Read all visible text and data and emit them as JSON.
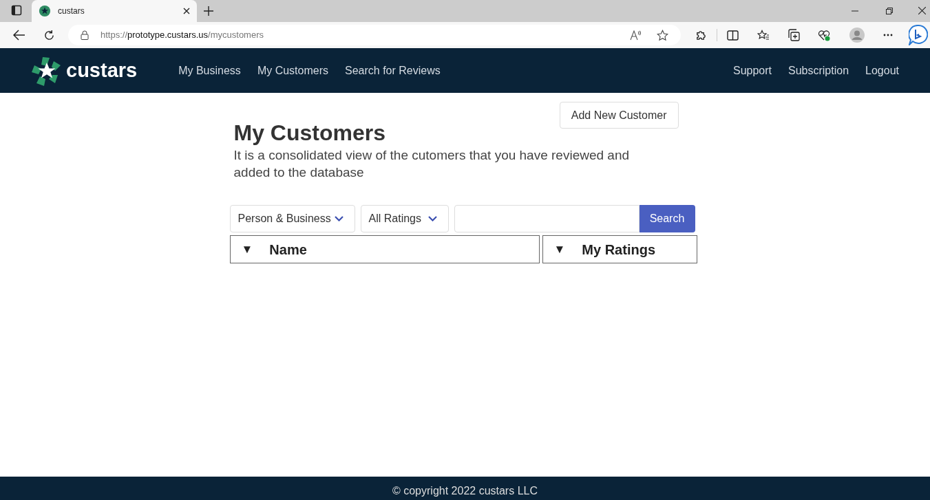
{
  "browser": {
    "tab": {
      "title": "custars",
      "selected": true
    },
    "url_parts": [
      {
        "text": "https://",
        "kind": "dim"
      },
      {
        "text": "prototype.custars.us",
        "kind": "main"
      },
      {
        "text": "/mycustomers",
        "kind": "dim"
      }
    ]
  },
  "nav": {
    "logo": "custars",
    "links": [
      "My Business",
      "My Customers",
      "Search for Reviews"
    ],
    "right_links": [
      "Support",
      "Subscription",
      "Logout"
    ]
  },
  "page": {
    "add_button": "Add New Customer",
    "title": "My Customers",
    "description": "It is a consolidated view of the cutomers that you have reviewed and added to the database",
    "filters": [
      {
        "value": "Person & Business"
      },
      {
        "value": "All Ratings"
      }
    ],
    "search_button": "Search",
    "columns": [
      {
        "arrow": "▼",
        "label": "Name"
      },
      {
        "arrow": "▼",
        "label": "My Ratings"
      }
    ]
  },
  "footer": "© copyright 2022 custars LLC"
}
